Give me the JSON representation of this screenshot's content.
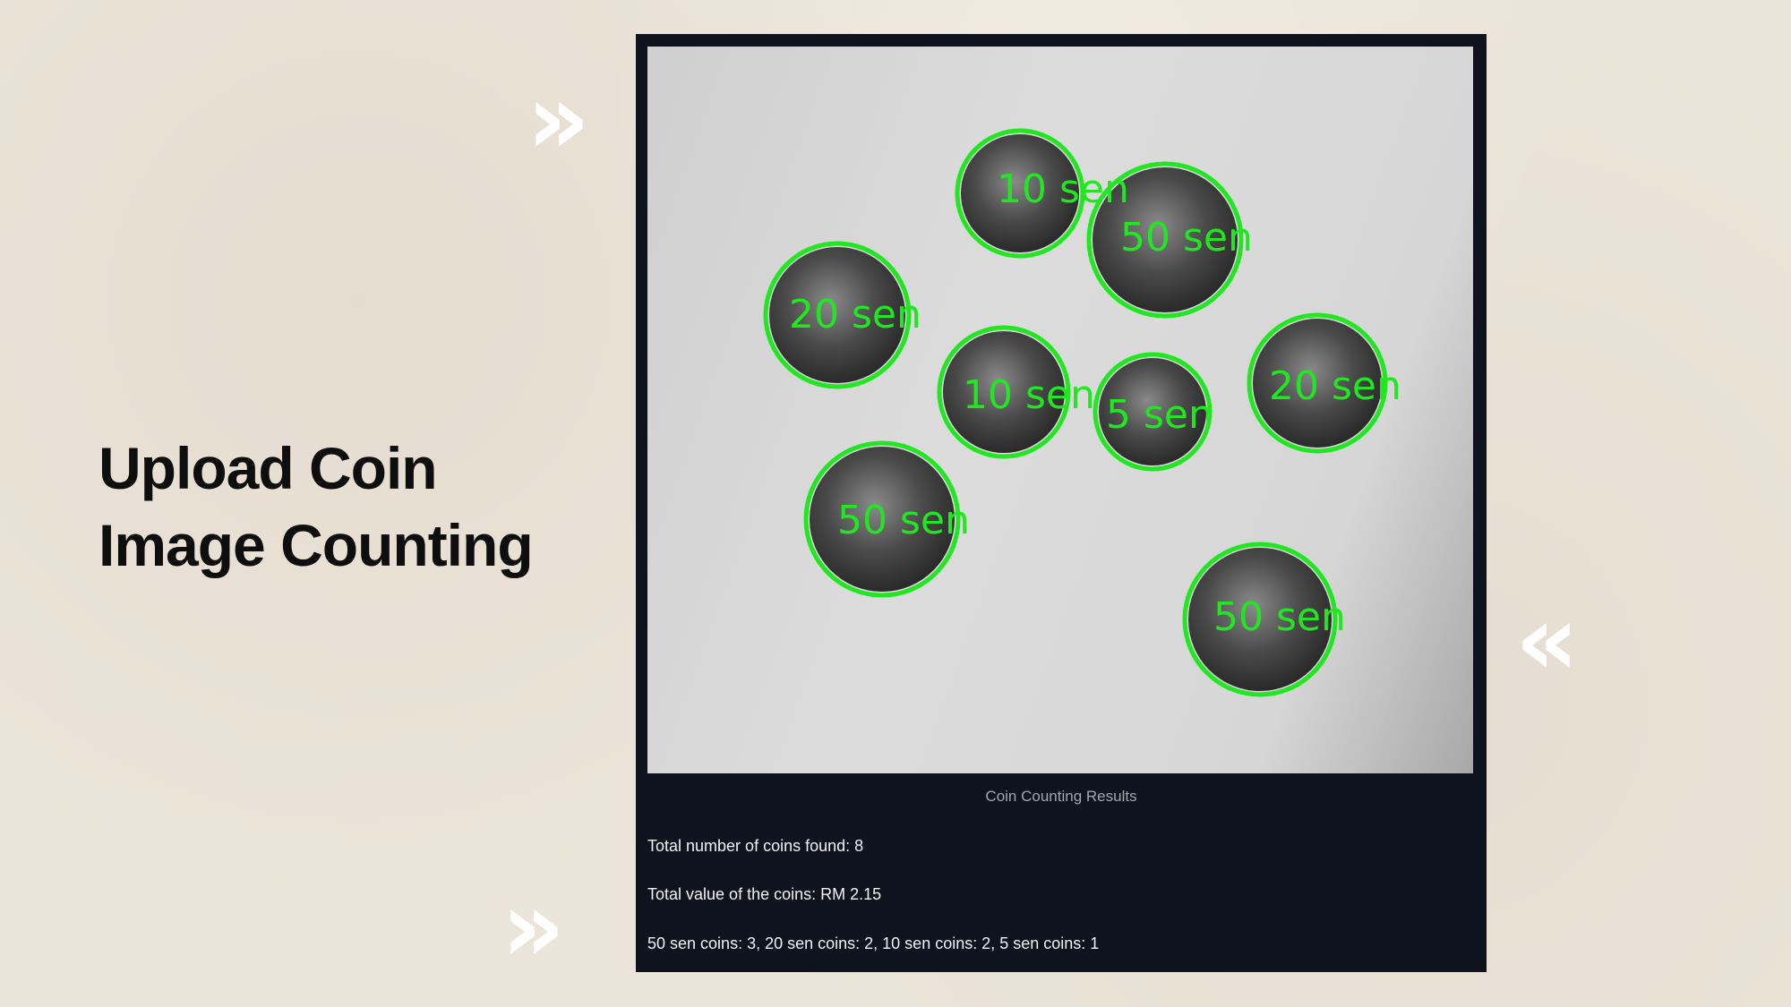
{
  "slide": {
    "title_line1": "Upload Coin",
    "title_line2": "Image Counting"
  },
  "decor": {
    "chevron_right": "»",
    "chevron_left": "«"
  },
  "result_image": {
    "coin_labels": [
      "10 sen",
      "50 sen",
      "20 sen",
      "10 sen",
      "5 sen",
      "20 sen",
      "50 sen",
      "50 sen"
    ],
    "detection_color": "#22e622"
  },
  "results": {
    "caption": "Coin Counting Results",
    "total_count": "Total number of coins found: 8",
    "total_value": "Total value of the coins: RM 2.15",
    "breakdown": "50 sen coins: 3, 20 sen coins: 2, 10 sen coins: 2, 5 sen coins: 1"
  }
}
